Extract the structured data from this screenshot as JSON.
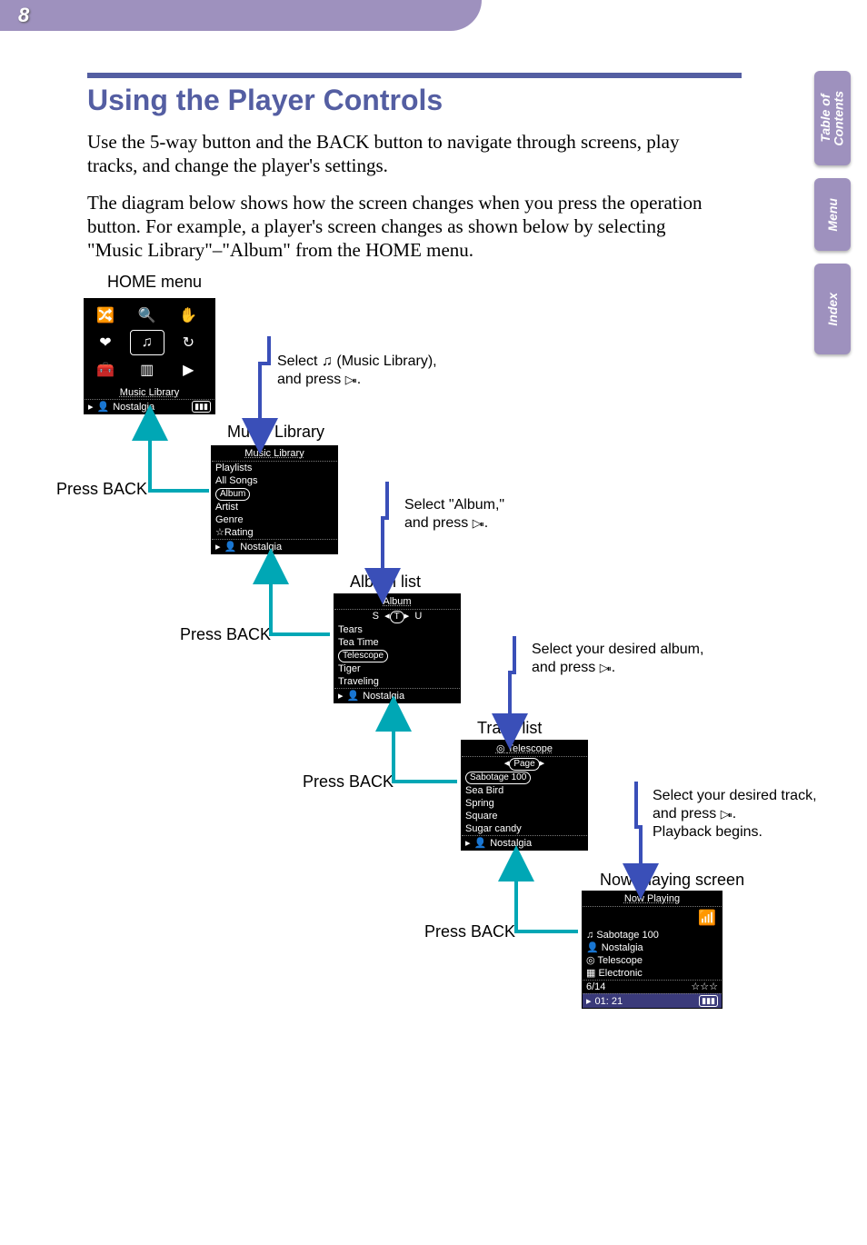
{
  "page_number": "8",
  "side_tabs": {
    "toc": "Table of\nContents",
    "menu": "Menu",
    "index": "Index"
  },
  "title": "Using the Player Controls",
  "body_p1": "Use the 5-way button and the BACK button to navigate through screens, play tracks, and change the player's settings.",
  "body_p2": "The diagram below shows how the screen changes when you press the operation button. For example, a player's screen changes as shown below by selecting \"Music Library\"–\"Album\" from the HOME menu.",
  "labels": {
    "home": "HOME menu",
    "lib": "Music Library",
    "album": "Album list",
    "track": "Track list",
    "now": "Now Playing screen",
    "back": "Press BACK"
  },
  "instr": {
    "sel_lib_a": "Select ",
    "sel_lib_b": " (Music Library),",
    "press": "and press ",
    "sel_album": "Select \"Album,\"",
    "sel_des_album": "Select your desired album,",
    "sel_des_track": "Select your desired track,",
    "playback": "Playback begins."
  },
  "screen_home": {
    "footer_title": "Music Library",
    "footer_song": "Nostalgia"
  },
  "screen_lib": {
    "hdr": "Music Library",
    "items": [
      "Playlists",
      "All Songs",
      "Album",
      "Artist",
      "Genre",
      "Rating"
    ],
    "sel_index": 2,
    "footer_song": "Nostalgia"
  },
  "screen_album": {
    "hdr": "Album",
    "letters": [
      "S",
      "T",
      "U"
    ],
    "items": [
      "Tears",
      "Tea Time",
      "Telescope",
      "Tiger",
      "Traveling"
    ],
    "sel_index": 2,
    "footer_song": "Nostalgia"
  },
  "screen_track": {
    "hdr": "Telescope",
    "page": "Page",
    "items": [
      "Sabotage 100",
      "Sea Bird",
      "Spring",
      "Square",
      "Sugar candy"
    ],
    "sel_index": 0,
    "footer_song": "Nostalgia"
  },
  "screen_now": {
    "hdr": "Now Playing",
    "song": "Sabotage 100",
    "artist": "Nostalgia",
    "album": "Telescope",
    "genre": "Electronic",
    "track_no": "6/14",
    "time": "01: 21",
    "stars": "☆☆☆"
  }
}
